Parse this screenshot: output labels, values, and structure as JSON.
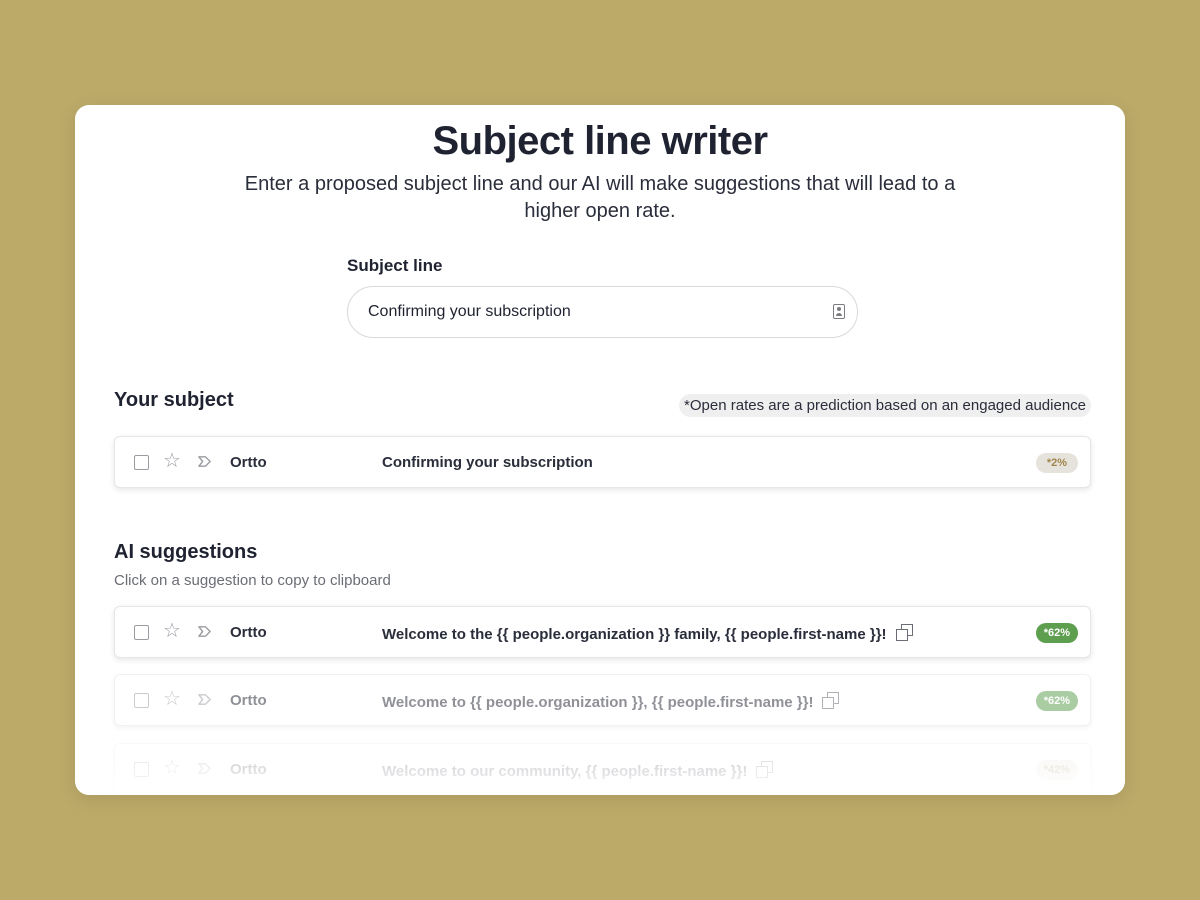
{
  "header": {
    "title": "Subject line writer",
    "subtitle": "Enter a proposed subject line and our AI will make suggestions that will lead to a higher open rate."
  },
  "subject_field": {
    "label": "Subject line",
    "value": "Confirming your subscription",
    "icon": "contact-card-icon"
  },
  "your_subject": {
    "heading": "Your subject",
    "note": "*Open rates are a prediction based on an engaged audience",
    "row": {
      "sender": "Ortto",
      "subject": "Confirming your subscription",
      "open_rate": "*2%"
    }
  },
  "ai_suggestions": {
    "heading": "AI suggestions",
    "helper": "Click on a suggestion to copy to clipboard",
    "items": [
      {
        "sender": "Ortto",
        "subject": "Welcome to the {{ people.organization }} family, {{ people.first-name }}!",
        "open_rate": "*62%"
      },
      {
        "sender": "Ortto",
        "subject": "Welcome to {{ people.organization }}, {{ people.first-name }}!",
        "open_rate": "*62%"
      },
      {
        "sender": "Ortto",
        "subject": "Welcome to our community, {{ people.first-name }}!",
        "open_rate": "*42%"
      }
    ]
  },
  "colors": {
    "background": "#bcaa69",
    "card": "#ffffff",
    "badge_green": "#5e9e4f",
    "badge_neutral": "#e6e3dc"
  }
}
